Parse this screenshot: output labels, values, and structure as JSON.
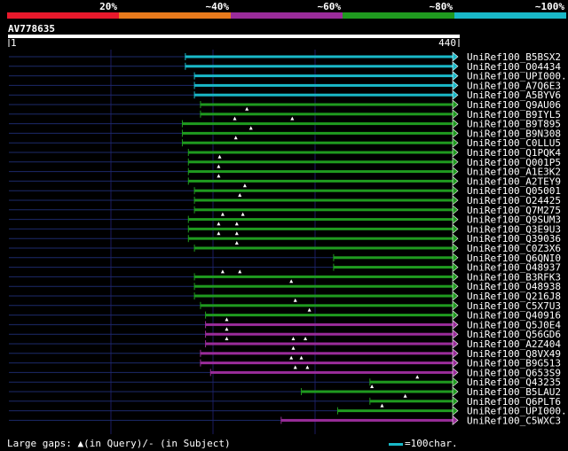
{
  "query": {
    "name": "AV778635",
    "start_label": "1",
    "end_label": "440"
  },
  "identity_scale": {
    "labels": [
      "20%",
      "~40%",
      "~60%",
      "~80%",
      "~100%"
    ],
    "colors": [
      "#e8192c",
      "#e87a1c",
      "#9a2c9a",
      "#1f9a1f",
      "#19b8c8"
    ]
  },
  "footer": {
    "legend": "Large gaps: ▲(in Query)/- (in Subject)",
    "scale_label": "=100char."
  },
  "chart_data": {
    "type": "alignment",
    "query_length": 440,
    "identity_bins": [
      "20%",
      "~40%",
      "~60%",
      "~80%",
      "~100%"
    ],
    "hits": [
      {
        "id": "UniRef100_B5BSX2",
        "start": 175,
        "identity_bin": "~100%",
        "gaps": []
      },
      {
        "id": "UniRef100_O04434",
        "start": 175,
        "identity_bin": "~100%",
        "gaps": []
      },
      {
        "id": "UniRef100_UPI000..",
        "start": 184,
        "identity_bin": "~100%",
        "gaps": []
      },
      {
        "id": "UniRef100_A7Q6E3",
        "start": 184,
        "identity_bin": "~100%",
        "gaps": []
      },
      {
        "id": "UniRef100_A5BYV6",
        "start": 184,
        "identity_bin": "~100%",
        "gaps": []
      },
      {
        "id": "UniRef100_Q9AU06",
        "start": 190,
        "identity_bin": "~80%",
        "gaps": []
      },
      {
        "id": "UniRef100_B9IYL5",
        "start": 190,
        "identity_bin": "~80%",
        "gaps": [
          236
        ]
      },
      {
        "id": "UniRef100_B9T895",
        "start": 172,
        "identity_bin": "~80%",
        "gaps": [
          224,
          281
        ]
      },
      {
        "id": "UniRef100_B9N308",
        "start": 172,
        "identity_bin": "~80%",
        "gaps": [
          240
        ]
      },
      {
        "id": "UniRef100_C0LLU5",
        "start": 172,
        "identity_bin": "~80%",
        "gaps": [
          225
        ]
      },
      {
        "id": "UniRef100_Q1PQK4",
        "start": 178,
        "identity_bin": "~80%",
        "gaps": []
      },
      {
        "id": "UniRef100_Q001P5",
        "start": 178,
        "identity_bin": "~80%",
        "gaps": [
          209
        ]
      },
      {
        "id": "UniRef100_A1E3K2",
        "start": 178,
        "identity_bin": "~80%",
        "gaps": [
          208
        ]
      },
      {
        "id": "UniRef100_A2TEY9",
        "start": 178,
        "identity_bin": "~80%",
        "gaps": [
          208
        ]
      },
      {
        "id": "UniRef100_Q05001",
        "start": 184,
        "identity_bin": "~80%",
        "gaps": [
          234
        ]
      },
      {
        "id": "UniRef100_O24425",
        "start": 184,
        "identity_bin": "~80%",
        "gaps": [
          229
        ]
      },
      {
        "id": "UniRef100_Q7M275",
        "start": 184,
        "identity_bin": "~80%",
        "gaps": []
      },
      {
        "id": "UniRef100_Q9SUM3",
        "start": 178,
        "identity_bin": "~80%",
        "gaps": [
          212,
          232
        ]
      },
      {
        "id": "UniRef100_Q3E9U3",
        "start": 178,
        "identity_bin": "~80%",
        "gaps": [
          208,
          226
        ]
      },
      {
        "id": "UniRef100_Q39036",
        "start": 178,
        "identity_bin": "~80%",
        "gaps": [
          208,
          226
        ]
      },
      {
        "id": "UniRef100_C0Z3X6",
        "start": 184,
        "identity_bin": "~80%",
        "gaps": [
          226
        ]
      },
      {
        "id": "UniRef100_Q6QNI0",
        "start": 322,
        "identity_bin": "~80%",
        "gaps": []
      },
      {
        "id": "UniRef100_O48937",
        "start": 322,
        "identity_bin": "~80%",
        "gaps": []
      },
      {
        "id": "UniRef100_B3RFK3",
        "start": 184,
        "identity_bin": "~80%",
        "gaps": [
          212,
          229
        ]
      },
      {
        "id": "UniRef100_O48938",
        "start": 184,
        "identity_bin": "~80%",
        "gaps": [
          280
        ]
      },
      {
        "id": "UniRef100_Q216J8",
        "start": 184,
        "identity_bin": "~80%",
        "gaps": []
      },
      {
        "id": "UniRef100_C5X7U3",
        "start": 190,
        "identity_bin": "~80%",
        "gaps": [
          284
        ]
      },
      {
        "id": "UniRef100_Q40916",
        "start": 195,
        "identity_bin": "~80%",
        "gaps": [
          298
        ]
      },
      {
        "id": "UniRef100_Q5J0E4",
        "start": 195,
        "identity_bin": "~60%",
        "gaps": [
          216
        ]
      },
      {
        "id": "UniRef100_Q56GD6",
        "start": 195,
        "identity_bin": "~60%",
        "gaps": [
          216
        ]
      },
      {
        "id": "UniRef100_A2Z404",
        "start": 195,
        "identity_bin": "~60%",
        "gaps": [
          216,
          282,
          294
        ]
      },
      {
        "id": "UniRef100_Q8VX49",
        "start": 190,
        "identity_bin": "~60%",
        "gaps": [
          282
        ]
      },
      {
        "id": "UniRef100_B9G513",
        "start": 190,
        "identity_bin": "~60%",
        "gaps": [
          280,
          290
        ]
      },
      {
        "id": "UniRef100_Q653S9",
        "start": 200,
        "identity_bin": "~60%",
        "gaps": [
          284,
          296
        ]
      },
      {
        "id": "UniRef100_Q43235",
        "start": 358,
        "identity_bin": "~80%",
        "gaps": [
          405
        ]
      },
      {
        "id": "UniRef100_B5LAU2",
        "start": 290,
        "identity_bin": "~80%",
        "gaps": [
          360
        ]
      },
      {
        "id": "UniRef100_Q6PLT6",
        "start": 358,
        "identity_bin": "~80%",
        "gaps": [
          393
        ]
      },
      {
        "id": "UniRef100_UPI000..",
        "start": 326,
        "identity_bin": "~80%",
        "gaps": [
          370
        ]
      },
      {
        "id": "UniRef100_C5WXC3",
        "start": 270,
        "identity_bin": "~60%",
        "gaps": []
      }
    ]
  }
}
